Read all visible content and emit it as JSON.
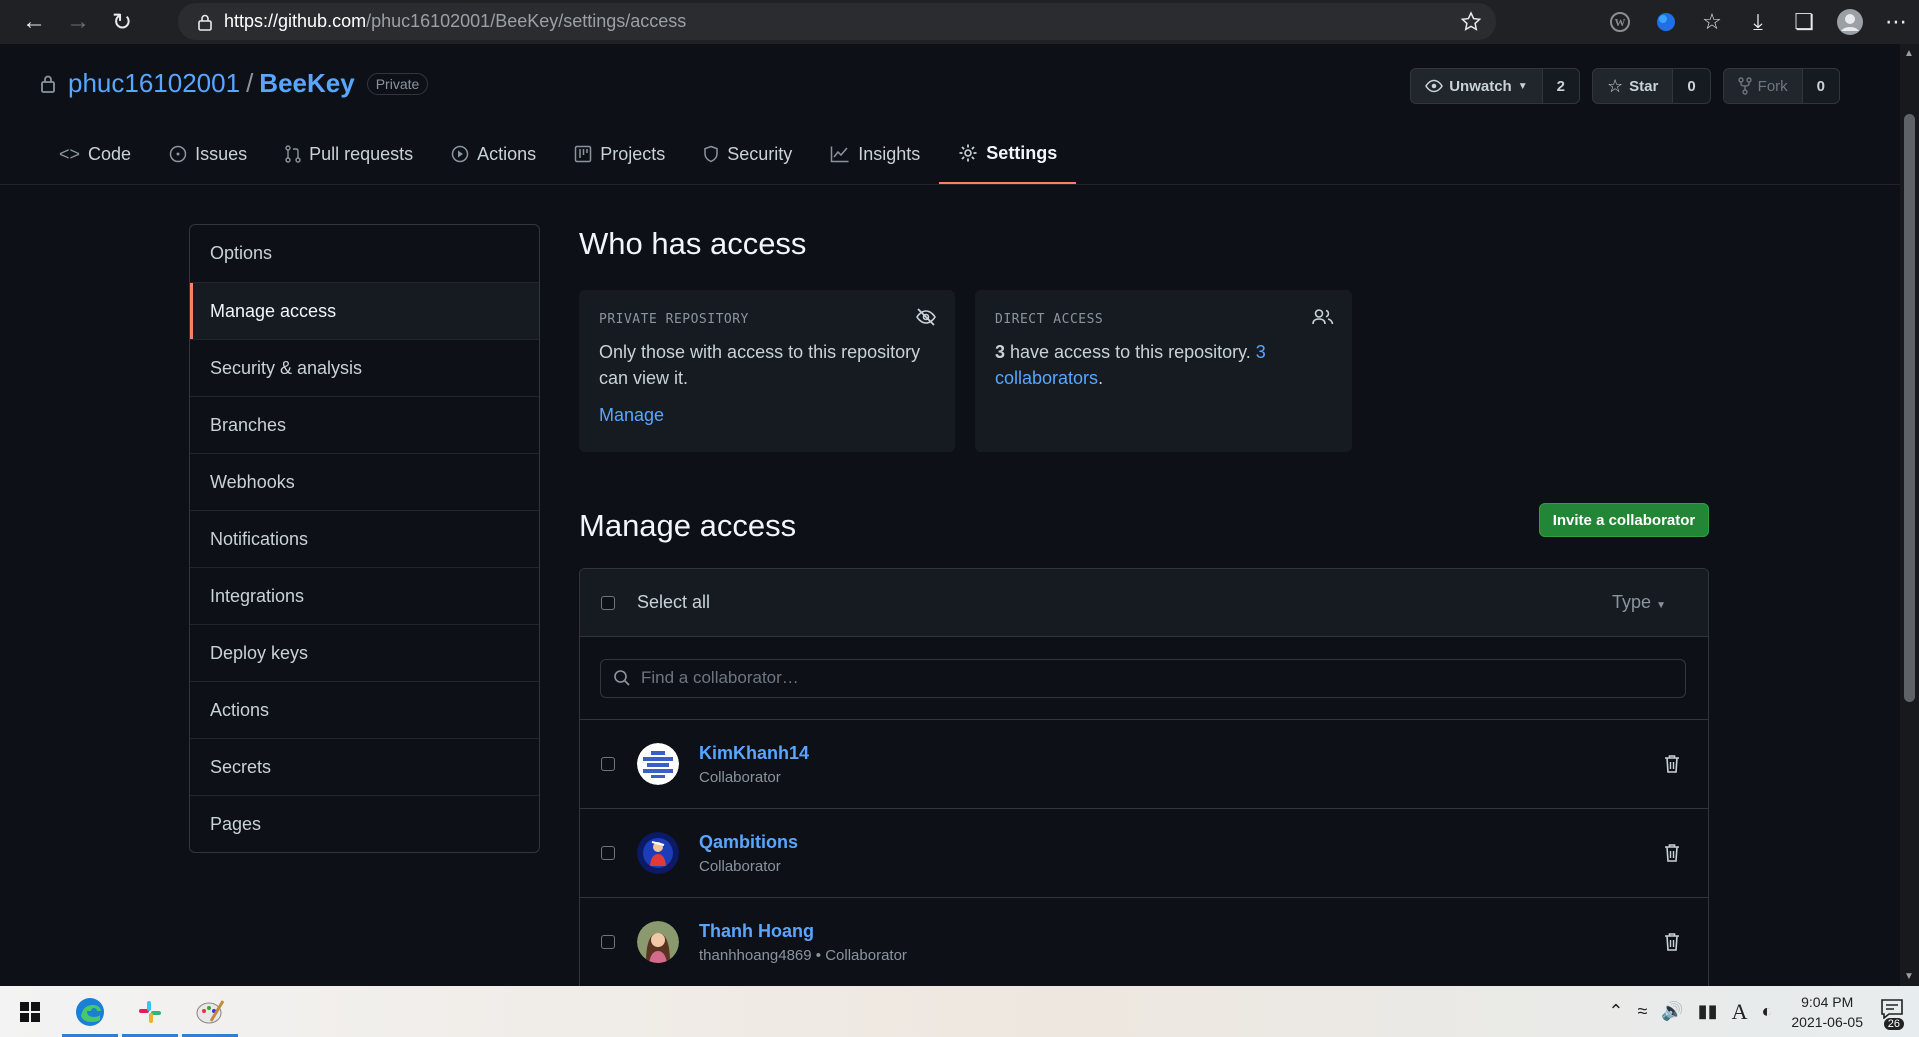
{
  "browser": {
    "url_host": "https://github.com",
    "url_path": "/phuc16102001/BeeKey/settings/access"
  },
  "repo": {
    "owner": "phuc16102001",
    "separator": "/",
    "name": "BeeKey",
    "visibility": "Private",
    "watch_label": "Unwatch",
    "watch_count": "2",
    "star_label": "Star",
    "star_count": "0",
    "fork_label": "Fork",
    "fork_count": "0",
    "tabs": [
      {
        "label": "Code",
        "icon": "code-icon"
      },
      {
        "label": "Issues",
        "icon": "issue-icon"
      },
      {
        "label": "Pull requests",
        "icon": "pull-request-icon"
      },
      {
        "label": "Actions",
        "icon": "play-icon"
      },
      {
        "label": "Projects",
        "icon": "project-icon"
      },
      {
        "label": "Security",
        "icon": "shield-icon"
      },
      {
        "label": "Insights",
        "icon": "graph-icon"
      },
      {
        "label": "Settings",
        "icon": "gear-icon",
        "active": true
      }
    ]
  },
  "sidebar": {
    "items": [
      {
        "label": "Options"
      },
      {
        "label": "Manage access",
        "active": true
      },
      {
        "label": "Security & analysis"
      },
      {
        "label": "Branches"
      },
      {
        "label": "Webhooks"
      },
      {
        "label": "Notifications"
      },
      {
        "label": "Integrations"
      },
      {
        "label": "Deploy keys"
      },
      {
        "label": "Actions"
      },
      {
        "label": "Secrets"
      },
      {
        "label": "Pages"
      }
    ]
  },
  "who_has_access": {
    "title": "Who has access",
    "private_card": {
      "label": "PRIVATE REPOSITORY",
      "text": "Only those with access to this repository can view it.",
      "link": "Manage"
    },
    "direct_card": {
      "label": "DIRECT ACCESS",
      "count": "3",
      "text": " have access to this repository. ",
      "link": "3 collaborators",
      "suffix": "."
    }
  },
  "manage_access": {
    "title": "Manage access",
    "invite_button": "Invite a collaborator",
    "select_all": "Select all",
    "type_filter": "Type",
    "search_placeholder": "Find a collaborator…",
    "collaborators": [
      {
        "name": "KimKhanh14",
        "role": "Collaborator"
      },
      {
        "name": "Qambitions",
        "role": "Collaborator"
      },
      {
        "name": "Thanh Hoang",
        "role": "thanhhoang4869 • Collaborator"
      }
    ]
  },
  "taskbar": {
    "time": "9:04 PM",
    "date": "2021-06-05",
    "notification_count": "26",
    "ime_label": "A"
  },
  "colors": {
    "background": "#0d1117",
    "link": "#58a6ff",
    "accent_tab": "#f78166",
    "invite_green": "#238636"
  }
}
